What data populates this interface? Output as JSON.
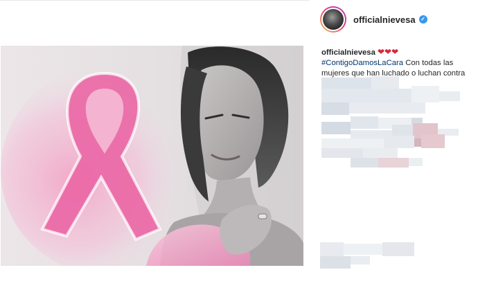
{
  "post": {
    "username": "officialnievesa",
    "verified_glyph": "✓",
    "caption": {
      "username": "officialnievesa",
      "emojis": "❤❤❤",
      "hashtag": "#ContigoDamosLaCara",
      "text": "Con todas las mujeres que han luchado o luchan contra esta"
    }
  },
  "icons": {
    "verified": "verified-badge-icon",
    "ribbon": "pink-ribbon-icon"
  },
  "colors": {
    "link": "#003569",
    "verified": "#3897f0",
    "ribbon": "#e8559b",
    "heart": "#d5263a"
  }
}
